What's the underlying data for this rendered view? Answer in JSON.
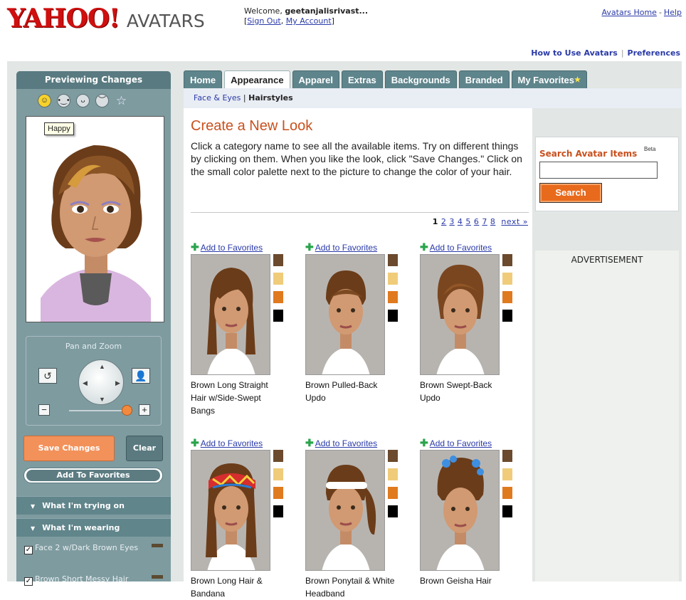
{
  "header": {
    "logo_text": "YAHOO!",
    "logo_sub": "AVATARS",
    "welcome_prefix": "Welcome, ",
    "username": "geetanjalisrivast...",
    "sign_out": "Sign Out",
    "my_account": "My Account",
    "avatars_home": "Avatars Home",
    "help": "Help",
    "how_to_use": "How to Use Avatars",
    "preferences": "Preferences"
  },
  "preview_panel": {
    "title": "Previewing Changes",
    "tooltip": "Happy",
    "moods": [
      "happy-face",
      "neutral-face",
      "open-mouth-face",
      "frown-face",
      "star"
    ],
    "pan_zoom_title": "Pan and Zoom",
    "zoom_level": 0.92,
    "save_label": "Save Changes",
    "clear_label": "Clear",
    "add_to_favorites": "Add To Favorites",
    "trying_on": "What I'm trying on",
    "wearing": "What I'm wearing",
    "wearing_items": [
      "Face 2 w/Dark Brown Eyes",
      "Brown Short Messy Hair"
    ]
  },
  "tabs": [
    "Home",
    "Appearance",
    "Apparel",
    "Extras",
    "Backgrounds",
    "Branded",
    "My Favorites"
  ],
  "active_tab": "Appearance",
  "subtabs": {
    "face_eyes": "Face & Eyes",
    "separator": " | ",
    "hairstyles": "Hairstyles"
  },
  "main": {
    "heading": "Create a New Look",
    "intro": "Click a category name to see all the available items. Try on different things by clicking on them. When you like the look, click \"Save Changes.\" Click on the small color palette next to the picture to change the color of your hair.",
    "pager": {
      "current": "1",
      "pages": [
        "2",
        "3",
        "4",
        "5",
        "6",
        "7",
        "8"
      ],
      "next": "next »"
    },
    "add_fav_label": "Add to Favorites",
    "items": [
      {
        "name": "Brown Long Straight Hair w/Side-Swept Bangs"
      },
      {
        "name": "Brown Pulled-Back Updo"
      },
      {
        "name": "Brown Swept-Back Updo"
      },
      {
        "name": "Brown Long Hair & Bandana"
      },
      {
        "name": "Brown Ponytail & White Headband"
      },
      {
        "name": "Brown Geisha Hair"
      }
    ],
    "swatch_colors": [
      "#6b4a2e",
      "#f0cc7a",
      "#e07a1e",
      "#000000"
    ]
  },
  "search": {
    "label": "Search Avatar Items",
    "beta": "Beta",
    "value": "",
    "button": "Search"
  },
  "ad": {
    "label": "ADVERTISEMENT"
  },
  "colors": {
    "yahoo_red": "#d00f0f",
    "tab_teal": "#5f858c",
    "accent_orange": "#c9501e",
    "save_orange": "#f3915a"
  }
}
